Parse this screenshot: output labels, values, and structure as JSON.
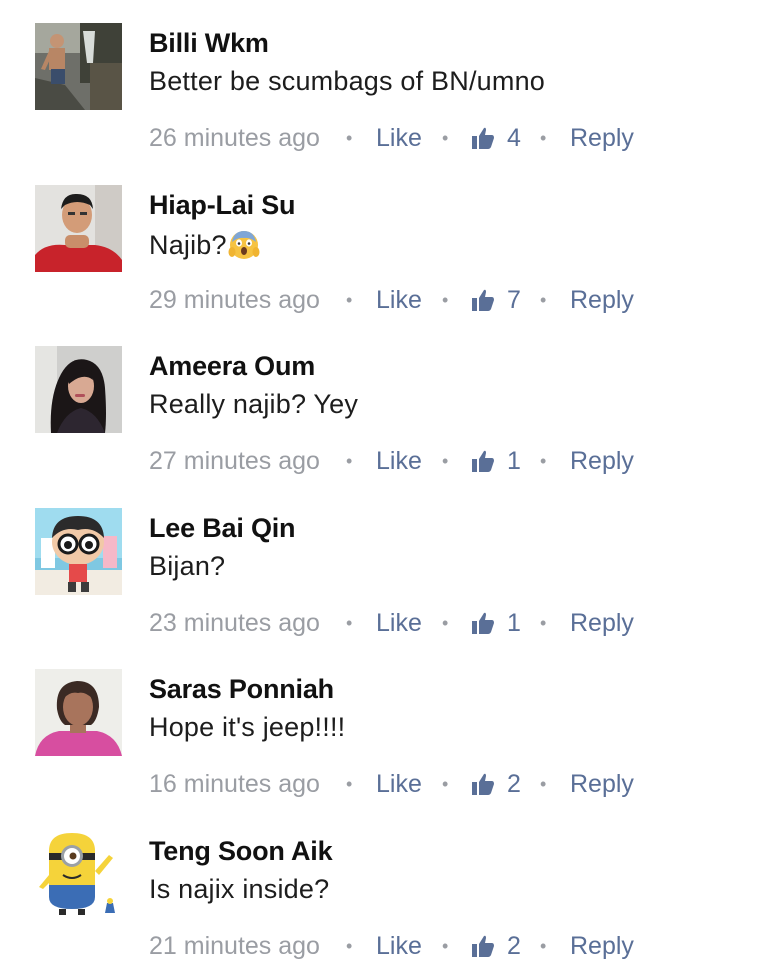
{
  "comments": [
    {
      "name": "Billi Wkm",
      "text": "Better be scumbags of BN/umno",
      "emoji": "",
      "time": "26 minutes ago",
      "like_label": "Like",
      "like_count": "4",
      "reply_label": "Reply"
    },
    {
      "name": "Hiap-Lai Su",
      "text": "Najib?",
      "emoji": "face-screaming-in-fear-emoji",
      "time": "29 minutes ago",
      "like_label": "Like",
      "like_count": "7",
      "reply_label": "Reply"
    },
    {
      "name": "Ameera Oum",
      "text": "Really najib? Yey",
      "emoji": "",
      "time": "27 minutes ago",
      "like_label": "Like",
      "like_count": "1",
      "reply_label": "Reply"
    },
    {
      "name": "Lee Bai Qin",
      "text": "Bijan?",
      "emoji": "",
      "time": "23 minutes ago",
      "like_label": "Like",
      "like_count": "1",
      "reply_label": "Reply"
    },
    {
      "name": "Saras Ponniah",
      "text": "Hope it's jeep!!!!",
      "emoji": "",
      "time": "16 minutes ago",
      "like_label": "Like",
      "like_count": "2",
      "reply_label": "Reply"
    },
    {
      "name": "Teng Soon Aik",
      "text": "Is najix inside?",
      "emoji": "",
      "time": "21 minutes ago",
      "like_label": "Like",
      "like_count": "2",
      "reply_label": "Reply"
    }
  ],
  "colors": {
    "name": "#111111",
    "text": "#1d1d1d",
    "time": "#9a9da3",
    "action": "#5a6f97",
    "background": "#ffffff"
  },
  "icons": {
    "bullet": "•",
    "like_count_icon": "thumbs-up-icon"
  }
}
